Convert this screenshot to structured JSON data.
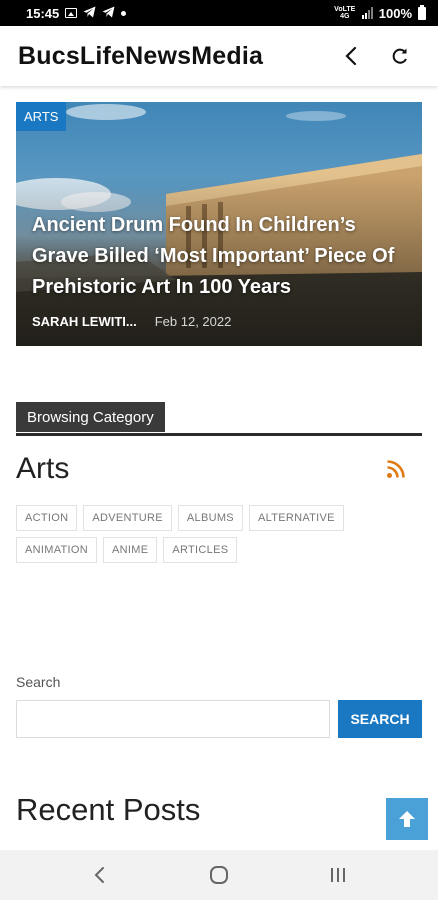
{
  "status_bar": {
    "time": "15:45",
    "network": "VoLTE 4G",
    "battery": "100%"
  },
  "app_bar": {
    "title": "BucsLifeNewsMedia",
    "back_icon": "chevron-left-icon",
    "refresh_icon": "refresh-icon"
  },
  "hero": {
    "badge": "ARTS",
    "title": "Ancient Drum Found In Children’s Grave Billed ‘Most Important’ Piece Of Prehistoric Art In 100 Years",
    "author": "SARAH LEWITI...",
    "date": "Feb 12, 2022"
  },
  "browsing": {
    "label": "Browsing Category",
    "category": "Arts",
    "rss_icon": "rss-icon",
    "rss_color": "#e07b14",
    "tags": [
      "ACTION",
      "ADVENTURE",
      "ALBUMS",
      "ALTERNATIVE",
      "ANIMATION",
      "ANIME",
      "ARTICLES"
    ]
  },
  "search": {
    "label": "Search",
    "value": "",
    "button": "SEARCH"
  },
  "recent_posts": {
    "heading": "Recent Posts"
  },
  "colors": {
    "accent": "#1a78c2",
    "scroll_top": "#4aa1d8"
  },
  "nav": {
    "back_icon": "nav-back-icon",
    "home_icon": "nav-home-icon",
    "recents_icon": "nav-recents-icon"
  }
}
